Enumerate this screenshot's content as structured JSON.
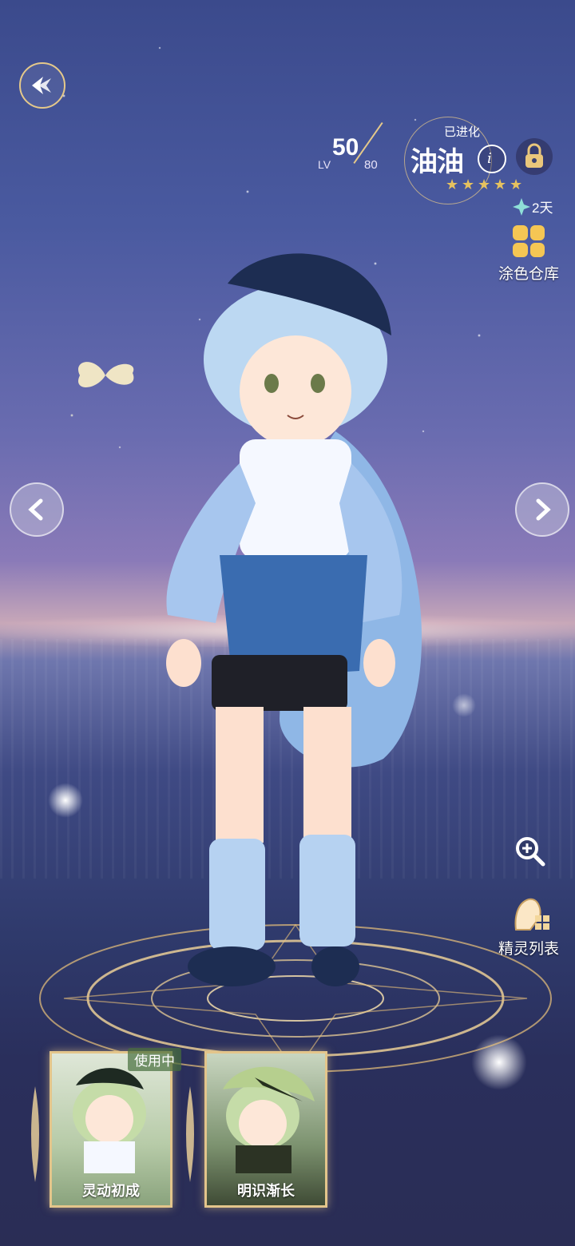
{
  "character": {
    "status": "已进化",
    "name": "油油",
    "level": "50",
    "level_label": "LV",
    "max_level": "80",
    "stars": 5,
    "days": "2天"
  },
  "buttons": {
    "paint_warehouse": "涂色仓库",
    "spirit_list": "精灵列表"
  },
  "cards": [
    {
      "label": "灵动初成",
      "status": "使用中"
    },
    {
      "label": "明识渐长"
    }
  ],
  "colors": {
    "accent_gold": "#e5c98a",
    "star_gold": "#e6c25f",
    "paint_yellow": "#f5c654"
  },
  "icons": {
    "back": "winged-back-icon",
    "edit": "info-i-icon",
    "lock": "lock-icon",
    "days": "four-point-star-icon",
    "zoom": "magnifier-plus-icon",
    "list": "spirit-list-icon"
  }
}
